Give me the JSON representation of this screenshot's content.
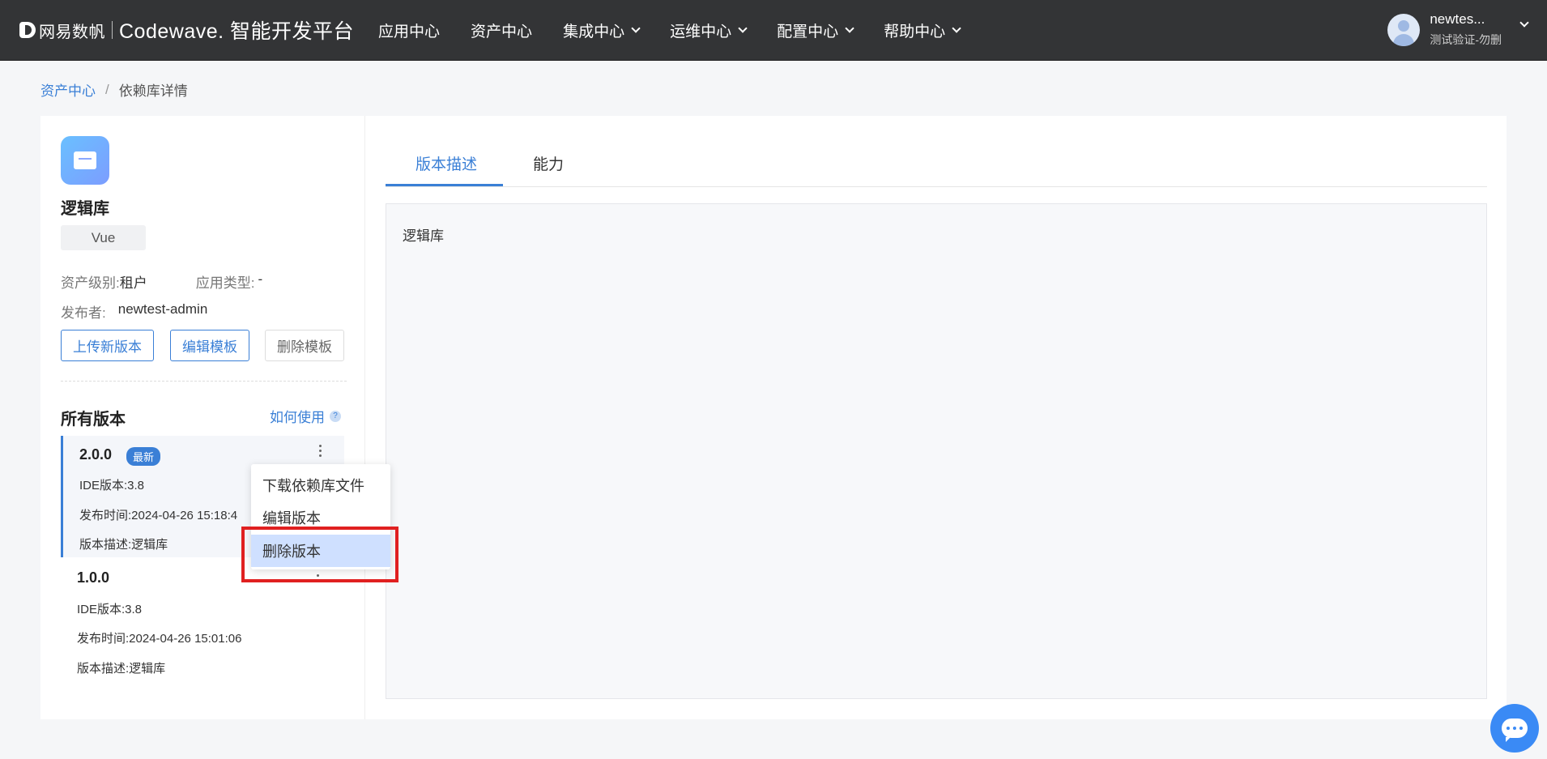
{
  "header": {
    "brand_company": "网易数帆",
    "brand_product": "Codewave. 智能开发平台",
    "nav": [
      {
        "label": "应用中心",
        "dropdown": false
      },
      {
        "label": "资产中心",
        "dropdown": false
      },
      {
        "label": "集成中心",
        "dropdown": true
      },
      {
        "label": "运维中心",
        "dropdown": true
      },
      {
        "label": "配置中心",
        "dropdown": true
      },
      {
        "label": "帮助中心",
        "dropdown": true
      }
    ],
    "user_name": "newtes...",
    "user_org": "测试验证-勿删"
  },
  "breadcrumb": {
    "parent": "资产中心",
    "separator": "/",
    "current": "依赖库详情"
  },
  "library": {
    "title": "逻辑库",
    "tag": "Vue",
    "asset_level_label": "资产级别:",
    "asset_level_value": "租户",
    "app_type_label": "应用类型:",
    "app_type_value": "-",
    "publisher_label": "发布者:",
    "publisher_value": "newtest-admin",
    "buttons": {
      "upload": "上传新版本",
      "edit_template": "编辑模板",
      "delete_template": "删除模板"
    }
  },
  "versions": {
    "title": "所有版本",
    "howto": "如何使用",
    "howto_icon": "?",
    "items": [
      {
        "version": "2.0.0",
        "badge": "最新",
        "ide": "IDE版本:3.8",
        "published": "发布时间:2024-04-26 15:18:4",
        "desc": "版本描述:逻辑库"
      },
      {
        "version": "1.0.0",
        "badge": "",
        "ide": "IDE版本:3.8",
        "published": "发布时间:2024-04-26 15:01:06",
        "desc": "版本描述:逻辑库"
      }
    ]
  },
  "menu": {
    "items": [
      "下载依赖库文件",
      "编辑版本",
      "删除版本"
    ],
    "highlighted": "删除版本",
    "highlight_color": "#e02020"
  },
  "detail": {
    "tabs": [
      "版本描述",
      "能力"
    ],
    "active_tab": "版本描述",
    "description": "逻辑库"
  },
  "colors": {
    "accent": "#3a7fd6",
    "topbar": "#333436",
    "chat": "#3a8af5"
  },
  "icons": {
    "brand": "netease-logo-icon",
    "library": "folder-icon",
    "more": "kebab-menu-icon",
    "chat": "chat-bubble-icon"
  }
}
